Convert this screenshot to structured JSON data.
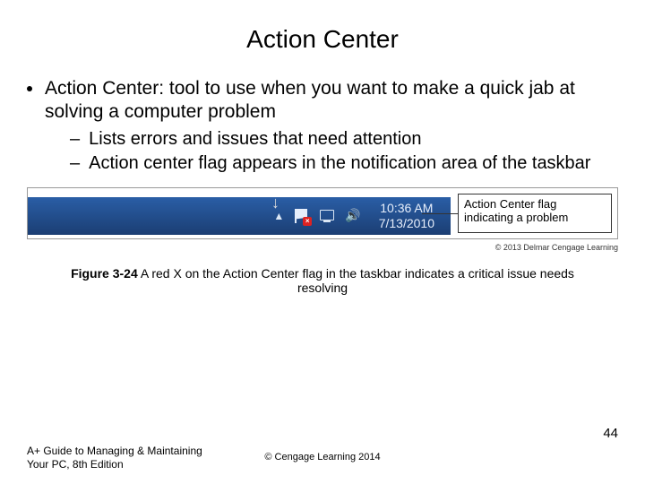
{
  "title": "Action Center",
  "bullets": {
    "main": "Action Center: tool to use when you want to make a quick jab at solving a computer problem",
    "sub1": "Lists errors and issues that need attention",
    "sub2": "Action center flag appears in the notification area of the taskbar"
  },
  "tray": {
    "time": "10:36 AM",
    "date": "7/13/2010"
  },
  "callout": "Action Center flag indicating a problem",
  "copyright_small": "© 2013 Delmar Cengage Learning",
  "caption": {
    "label": "Figure 3-24",
    "text": " A red X on the Action Center flag in the taskbar indicates a critical issue needs resolving"
  },
  "footer": {
    "left1": "A+ Guide to Managing & Maintaining",
    "left2": "Your PC, 8th Edition",
    "center": "© Cengage Learning  2014",
    "page": "44"
  }
}
